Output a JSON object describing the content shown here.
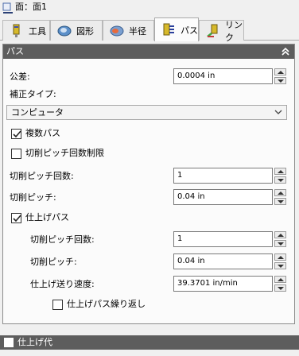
{
  "window": {
    "title": "面：面1"
  },
  "tabs": [
    {
      "label": "工具",
      "icon": "tool-icon",
      "active": false
    },
    {
      "label": "図形",
      "icon": "shape-icon",
      "active": false
    },
    {
      "label": "半径",
      "icon": "radius-icon",
      "active": false
    },
    {
      "label": "パス",
      "icon": "path-icon",
      "active": true
    },
    {
      "label": "リンク",
      "icon": "link-icon",
      "active": false
    }
  ],
  "panel": {
    "title": "パス",
    "tolerance": {
      "label": "公差:",
      "value": "0.0004 in"
    },
    "compensation_type": {
      "label": "補正タイプ:",
      "selected": "コンピュータ"
    },
    "multiple_passes": {
      "label": "複数パス",
      "checked": true
    },
    "limit_step_count": {
      "label": "切削ピッチ回数制限",
      "checked": false
    },
    "step_count": {
      "label": "切削ピッチ回数:",
      "value": "1"
    },
    "step_pitch": {
      "label": "切削ピッチ:",
      "value": "0.04 in"
    },
    "finish_pass": {
      "label": "仕上げパス",
      "checked": true
    },
    "finish_step_count": {
      "label": "切削ピッチ回数:",
      "value": "1"
    },
    "finish_step_pitch": {
      "label": "切削ピッチ:",
      "value": "0.04 in"
    },
    "finish_feed_rate": {
      "label": "仕上げ送り速度:",
      "value": "39.3701 in/min"
    },
    "repeat_finish_pass": {
      "label": "仕上げパス繰り返し",
      "checked": false
    }
  },
  "finish_allowance": {
    "label": "仕上げ代",
    "checked": false
  },
  "colors": {
    "header_bg": "#5d5d5d",
    "panel_bg": "#fbfbfb",
    "window_bg": "#f0f0f0"
  }
}
